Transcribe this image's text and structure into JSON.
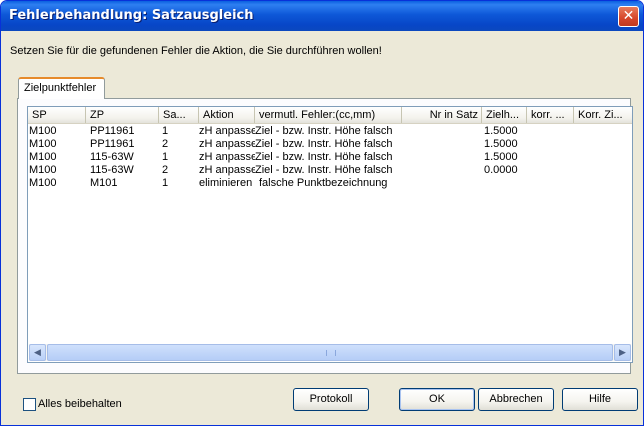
{
  "window": {
    "title": "Fehlerbehandlung: Satzausgleich",
    "close_glyph": "✕",
    "close_icon": "close-icon"
  },
  "instruction": "Setzen Sie für die gefundenen Fehler die Aktion, die Sie durchführen wollen!",
  "tabs": [
    {
      "label": "Zielpunktfehler"
    }
  ],
  "table": {
    "columns": [
      "SP",
      "ZP",
      "Sa...",
      "Aktion",
      "vermutl. Fehler:(cc,mm)",
      "Nr in Satz",
      "Zielh...",
      "korr. ...",
      "Korr. Zi..."
    ],
    "rows": [
      [
        "M100",
        "PP11961",
        "1",
        "zH anpassen",
        "Ziel - bzw. Instr. Höhe falsch",
        "",
        "1.5000",
        "",
        ""
      ],
      [
        "M100",
        "PP11961",
        "2",
        "zH anpassen",
        "Ziel - bzw. Instr. Höhe falsch",
        "",
        "1.5000",
        "",
        ""
      ],
      [
        "M100",
        "115-63W",
        "1",
        "zH anpassen",
        "Ziel - bzw. Instr. Höhe falsch",
        "",
        "1.5000",
        "",
        ""
      ],
      [
        "M100",
        "115-63W",
        "2",
        "zH anpassen",
        "Ziel - bzw. Instr. Höhe falsch",
        "",
        "0.0000",
        "",
        ""
      ],
      [
        "M100",
        "M101",
        "1",
        "eliminieren",
        "falsche Punktbezeichnung",
        "",
        "",
        "",
        ""
      ]
    ]
  },
  "scrollbar": {
    "left_icon": "scroll-left-icon",
    "right_icon": "scroll-right-icon",
    "left_glyph": "◀",
    "right_glyph": "▶"
  },
  "footer": {
    "keep_all_label": "Alles beibehalten",
    "keep_all_checked": false,
    "buttons": {
      "protokoll": "Protokoll",
      "ok": "OK",
      "abbrechen": "Abbrechen",
      "hilfe": "Hilfe"
    }
  },
  "colors": {
    "titlebar": "#0a5fe0",
    "dialog_bg": "#ece9d8",
    "tab_accent": "#e68b2c",
    "close_button": "#d6462a"
  }
}
